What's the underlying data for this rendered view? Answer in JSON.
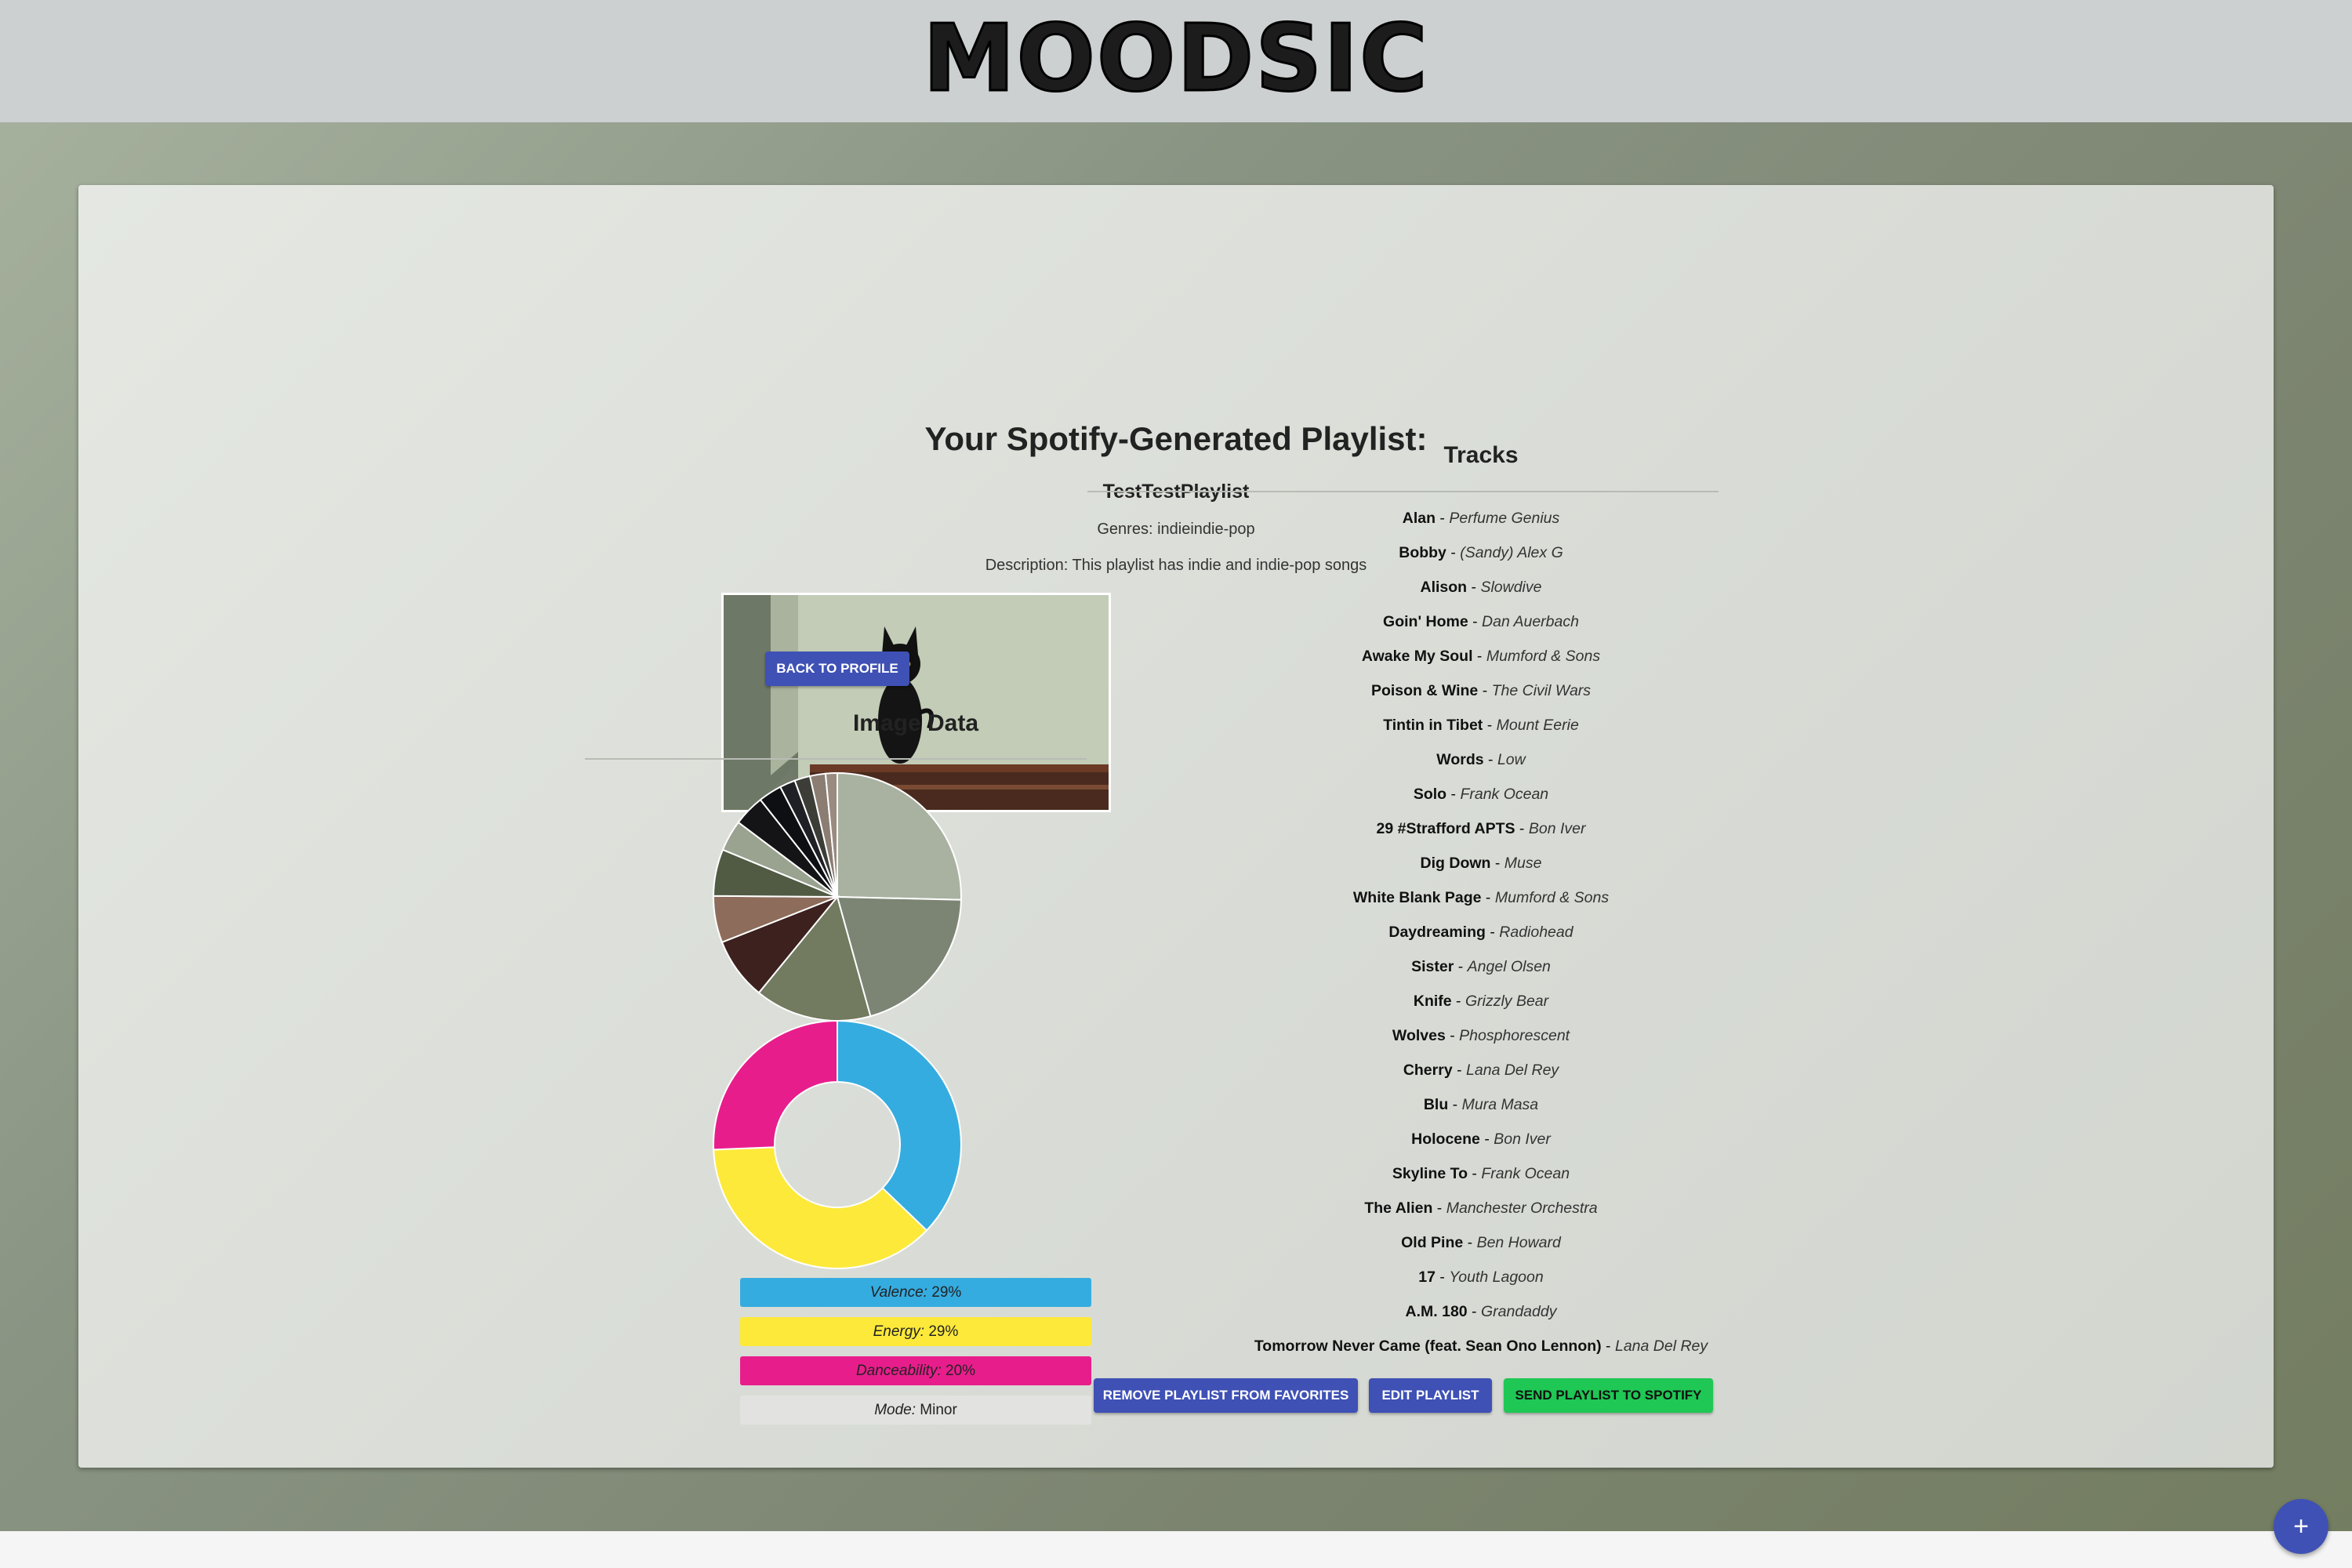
{
  "header": {
    "logo": "MOODSIC"
  },
  "playlist": {
    "heading": "Your Spotify-Generated Playlist:",
    "name": "TestTestPlaylist",
    "genres": "Genres: indieindie-pop",
    "description": "Description: This playlist has indie and indie-pop songs"
  },
  "buttons": {
    "back_to_profile": "BACK TO PROFILE",
    "remove_favorites": "REMOVE PLAYLIST FROM FAVORITES",
    "edit_playlist": "EDIT PLAYLIST",
    "send_spotify": "SEND PLAYLIST TO SPOTIFY",
    "fab": "+"
  },
  "image_data": {
    "heading": "Image Data"
  },
  "tracks": {
    "heading": "Tracks",
    "items": [
      {
        "title": "Alan",
        "artist": "Perfume Genius"
      },
      {
        "title": "Bobby",
        "artist": "(Sandy) Alex G"
      },
      {
        "title": "Alison",
        "artist": "Slowdive"
      },
      {
        "title": "Goin' Home",
        "artist": "Dan Auerbach"
      },
      {
        "title": "Awake My Soul",
        "artist": "Mumford & Sons"
      },
      {
        "title": "Poison & Wine",
        "artist": "The Civil Wars"
      },
      {
        "title": "Tintin in Tibet",
        "artist": "Mount Eerie"
      },
      {
        "title": "Words",
        "artist": "Low"
      },
      {
        "title": "Solo",
        "artist": "Frank Ocean"
      },
      {
        "title": "29 #Strafford APTS",
        "artist": "Bon Iver"
      },
      {
        "title": "Dig Down",
        "artist": "Muse"
      },
      {
        "title": "White Blank Page",
        "artist": "Mumford & Sons"
      },
      {
        "title": "Daydreaming",
        "artist": "Radiohead"
      },
      {
        "title": "Sister",
        "artist": "Angel Olsen"
      },
      {
        "title": "Knife",
        "artist": "Grizzly Bear"
      },
      {
        "title": "Wolves",
        "artist": "Phosphorescent"
      },
      {
        "title": "Cherry",
        "artist": "Lana Del Rey"
      },
      {
        "title": "Blu",
        "artist": "Mura Masa"
      },
      {
        "title": "Holocene",
        "artist": "Bon Iver"
      },
      {
        "title": "Skyline To",
        "artist": "Frank Ocean"
      },
      {
        "title": "The Alien",
        "artist": "Manchester Orchestra"
      },
      {
        "title": "Old Pine",
        "artist": "Ben Howard"
      },
      {
        "title": "17",
        "artist": "Youth Lagoon"
      },
      {
        "title": "A.M. 180",
        "artist": "Grandaddy"
      },
      {
        "title": "Tomorrow Never Came (feat. Sean Ono Lennon)",
        "artist": "Lana Del Rey"
      }
    ]
  },
  "metrics": [
    {
      "label": "Valence:",
      "value": "29%",
      "color": "#35ace0"
    },
    {
      "label": "Energy:",
      "value": "29%",
      "color": "#fde93a"
    },
    {
      "label": "Danceability:",
      "value": "20%",
      "color": "#e81d8c"
    },
    {
      "label": "Mode:",
      "value": "Minor",
      "color": "#e2e3e1"
    }
  ],
  "chart_data": [
    {
      "type": "pie",
      "values": [
        25,
        20,
        15,
        8,
        6,
        6,
        4,
        4,
        3,
        2,
        2,
        2,
        1.5
      ],
      "colors": [
        "#a9b2a1",
        "#7c8574",
        "#727a5f",
        "#3c211f",
        "#8d6c5b",
        "#515b44",
        "#9aa290",
        "#141416",
        "#0e0f12",
        "#1e2025",
        "#3c3d36",
        "#8b7d72",
        "#9a8b80"
      ]
    },
    {
      "type": "pie",
      "values": [
        29,
        29,
        20
      ],
      "labels": [
        "Valence",
        "Energy",
        "Danceability"
      ],
      "colors": [
        "#35ace0",
        "#fde93a",
        "#e81d8c"
      ]
    }
  ]
}
